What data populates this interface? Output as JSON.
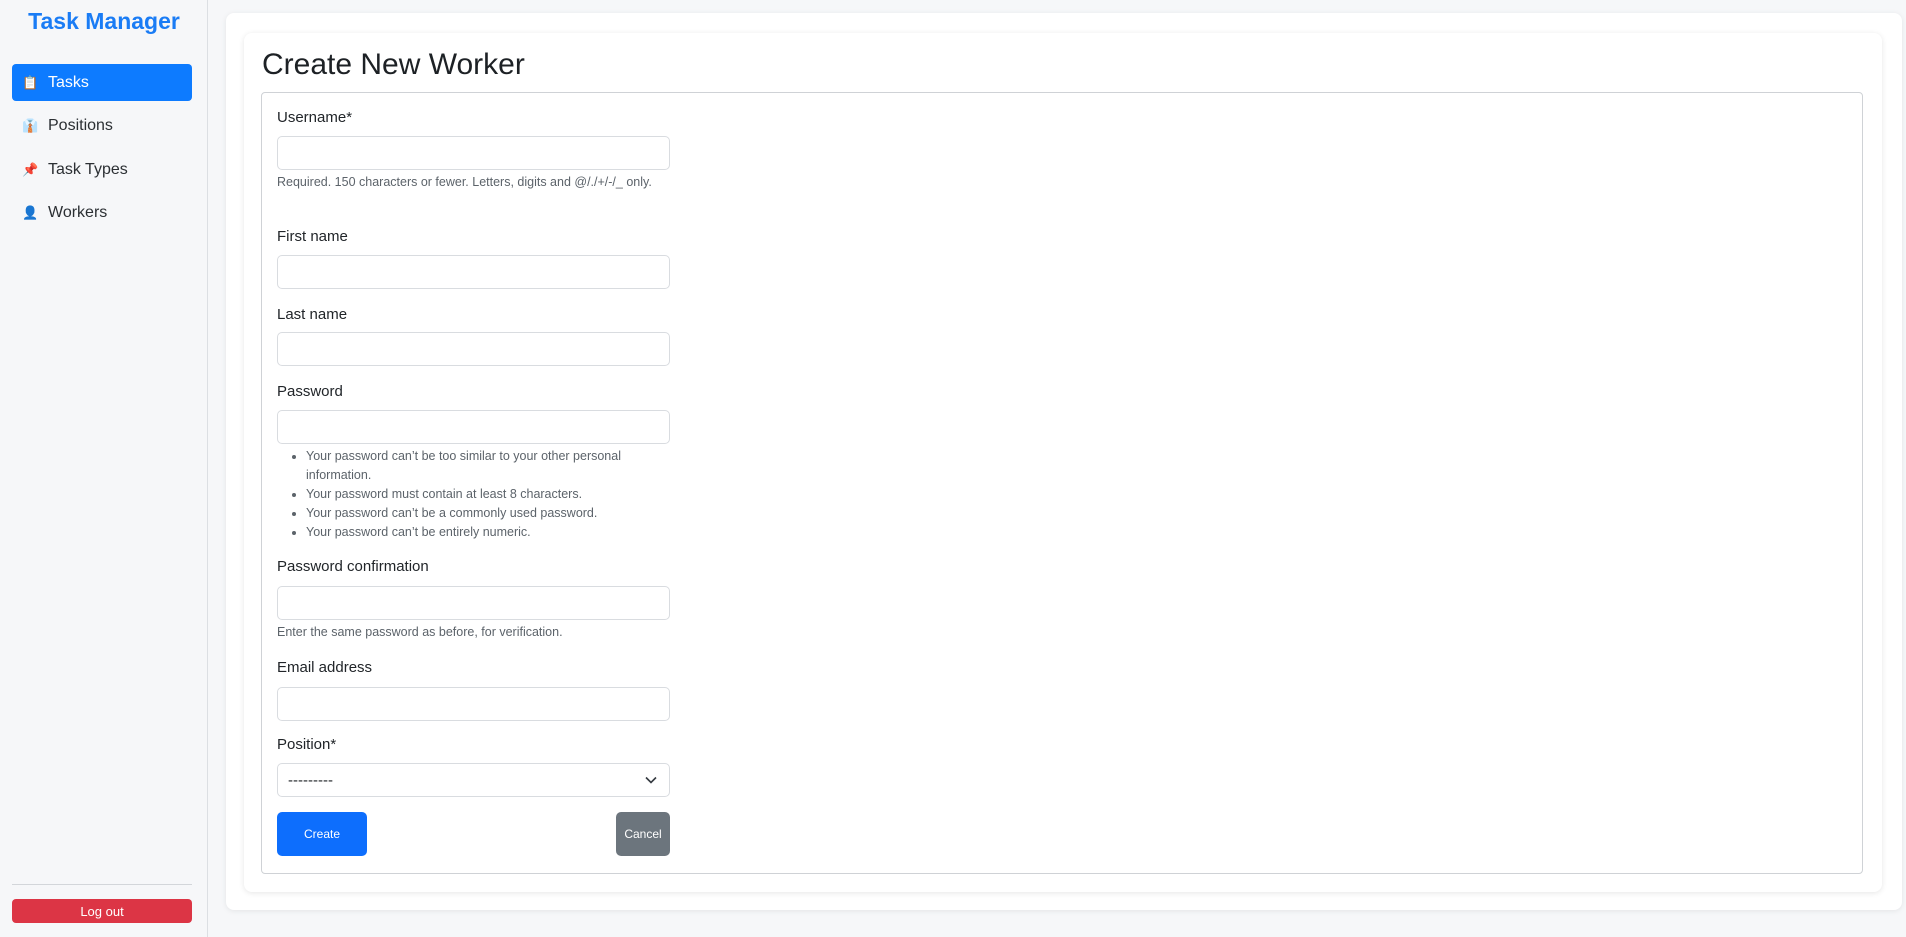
{
  "sidebar": {
    "brand": "Task Manager",
    "items": [
      {
        "label": "Tasks",
        "icon": "clipboard-icon",
        "glyph": "📋",
        "active": true
      },
      {
        "label": "Positions",
        "icon": "suit-icon",
        "glyph": "👔",
        "active": false
      },
      {
        "label": "Task Types",
        "icon": "pushpin-icon",
        "glyph": "📌",
        "active": false
      },
      {
        "label": "Workers",
        "icon": "person-icon",
        "glyph": "👤",
        "active": false
      }
    ],
    "logout": "Log out"
  },
  "page": {
    "title": "Create New Worker"
  },
  "form": {
    "username": {
      "label": "Username*",
      "value": "",
      "help": "Required. 150 characters or fewer. Letters, digits and @/./+/-/_ only."
    },
    "first_name": {
      "label": "First name",
      "value": ""
    },
    "last_name": {
      "label": "Last name",
      "value": ""
    },
    "password": {
      "label": "Password",
      "value": "",
      "rules": [
        "Your password can’t be too similar to your other personal information.",
        "Your password must contain at least 8 characters.",
        "Your password can’t be a commonly used password.",
        "Your password can’t be entirely numeric."
      ]
    },
    "password_confirmation": {
      "label": "Password confirmation",
      "value": "",
      "help": "Enter the same password as before, for verification."
    },
    "email": {
      "label": "Email address",
      "value": ""
    },
    "position": {
      "label": "Position*",
      "selected": "---------"
    },
    "create": "Create",
    "cancel": "Cancel"
  },
  "colors": {
    "primary": "#0d6efd",
    "danger": "#dc3545",
    "secondary": "#6c757d",
    "brand": "#1a7cf5"
  }
}
